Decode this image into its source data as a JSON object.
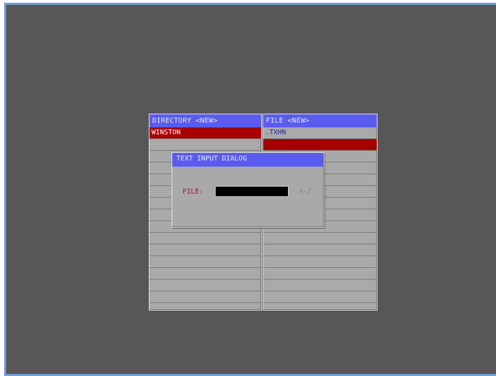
{
  "directory_panel": {
    "header": "DIRECTORY <NEW>",
    "rows": [
      "WINSTON",
      "",
      "",
      "",
      "",
      "",
      "",
      "",
      "",
      "",
      "",
      "",
      "",
      "",
      "",
      ""
    ]
  },
  "file_panel": {
    "header": "FILE <NEW>",
    "rows": [
      ".TXHN",
      "",
      "",
      "",
      "",
      "",
      "",
      "",
      "",
      "",
      "",
      "",
      "",
      "",
      "",
      ""
    ]
  },
  "dialog": {
    "title": "TEXT INPUT DIALOG",
    "field_label": "FILE:",
    "field_value": "",
    "range_hint": "A-Z"
  },
  "colors": {
    "background": "#575757",
    "header": "#5a5cf0",
    "selection": "#a80000",
    "panel": "#a9a9a9",
    "frame_border": "#6f9fd8"
  }
}
